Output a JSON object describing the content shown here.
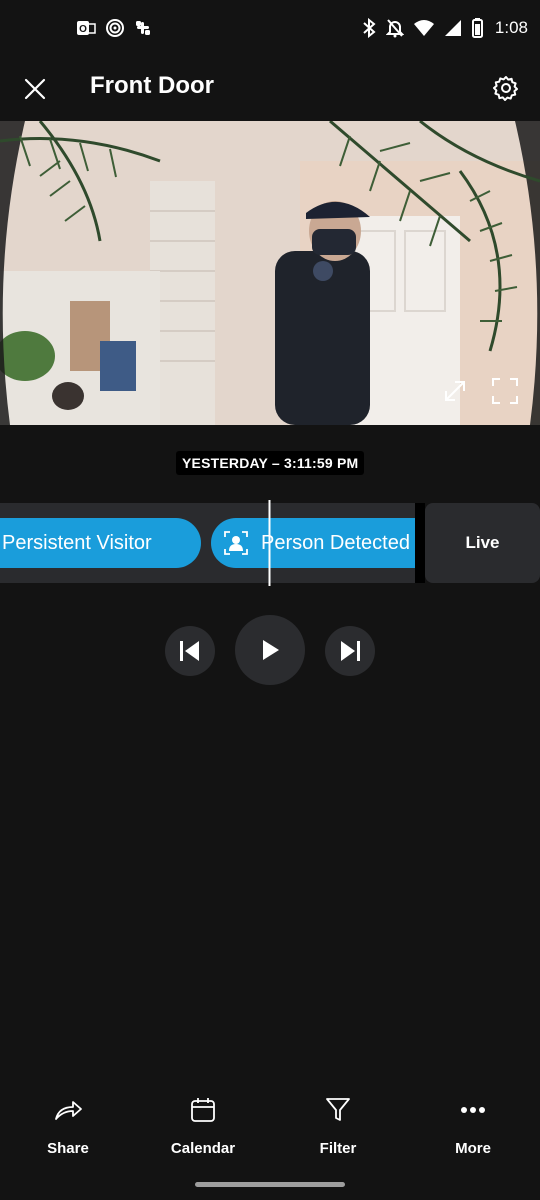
{
  "status_bar": {
    "time": "1:08",
    "left_icons": [
      "outlook-icon",
      "spotify-icon",
      "slack-icon"
    ],
    "right_icons": [
      "bluetooth-icon",
      "notifications-off-icon",
      "wifi-icon",
      "cellular-icon",
      "battery-icon"
    ]
  },
  "header": {
    "title": "Front Door",
    "close_icon": "close-icon",
    "settings_icon": "gear-icon"
  },
  "video": {
    "expand_icon": "expand-arrows-icon",
    "fullscreen_icon": "fullscreen-icon"
  },
  "timestamp": "YESTERDAY – 3:11:59 PM",
  "timeline": {
    "events": [
      {
        "label": "Persistent Visitor"
      },
      {
        "label": "Person Detected",
        "icon": "person-icon"
      }
    ],
    "live_label": "Live"
  },
  "playback": {
    "prev_icon": "skip-previous-icon",
    "play_icon": "play-icon",
    "next_icon": "skip-next-icon"
  },
  "bottom_nav": [
    {
      "label": "Share",
      "icon": "share-icon"
    },
    {
      "label": "Calendar",
      "icon": "calendar-icon"
    },
    {
      "label": "Filter",
      "icon": "filter-icon"
    },
    {
      "label": "More",
      "icon": "more-icon"
    }
  ],
  "colors": {
    "background": "#131313",
    "accent": "#1a9ddb",
    "track": "#2a2b2e"
  }
}
